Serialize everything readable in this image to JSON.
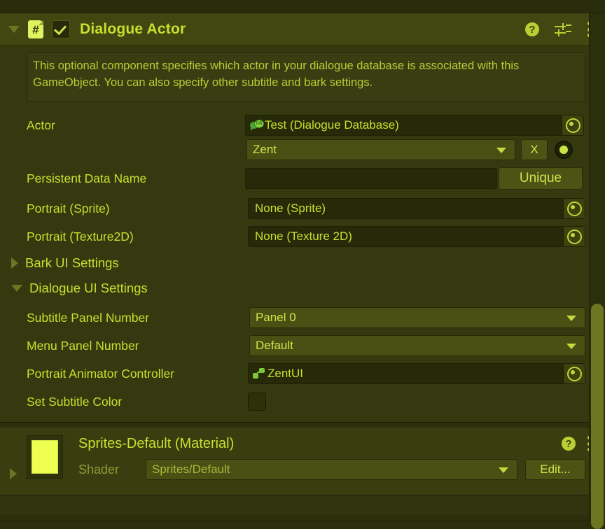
{
  "component": {
    "title": "Dialogue Actor",
    "enabled_checkbox": true,
    "script_icon_glyph": "#",
    "expanded": true,
    "help_text": "This optional component specifies which actor in your dialogue database is associated with this GameObject. You can also specify other subtitle and bark settings.",
    "header_icons": {
      "help": "help-icon",
      "preset": "preset-icon",
      "menu": "kebab-menu-icon"
    }
  },
  "fields": {
    "actor": {
      "label": "Actor",
      "object_value": "Test (Dialogue Database)",
      "object_icon": "dialogue-database-icon",
      "dropdown_value": "Zent",
      "clear_button": "X"
    },
    "persistent_data_name": {
      "label": "Persistent Data Name",
      "value": "",
      "button": "Unique"
    },
    "portrait_sprite": {
      "label": "Portrait (Sprite)",
      "value": "None (Sprite)"
    },
    "portrait_texture2d": {
      "label": "Portrait (Texture2D)",
      "value": "None (Texture 2D)"
    }
  },
  "foldouts": {
    "bark_ui": {
      "label": "Bark UI Settings",
      "expanded": false
    },
    "dialogue_ui": {
      "label": "Dialogue UI Settings",
      "expanded": true
    }
  },
  "dialogue_ui_fields": {
    "subtitle_panel_number": {
      "label": "Subtitle Panel Number",
      "value": "Panel 0"
    },
    "menu_panel_number": {
      "label": "Menu Panel Number",
      "value": "Default"
    },
    "portrait_animator_controller": {
      "label": "Portrait Animator Controller",
      "value": "ZentUI",
      "icon": "animator-controller-icon"
    },
    "set_subtitle_color": {
      "label": "Set Subtitle Color",
      "checked": false
    }
  },
  "material": {
    "title": "Sprites-Default (Material)",
    "preview_color": "#eeff52",
    "shader_label": "Shader",
    "shader_value": "Sprites/Default",
    "edit_button": "Edit...",
    "expanded": false
  },
  "colors": {
    "background": "#30340f",
    "header_bg": "#424711",
    "panel_bg": "#35390f",
    "text": "#c7e02e",
    "field_bg": "#262a08",
    "popup_bg": "#4a5014",
    "scrollbar": "#6d7722"
  }
}
